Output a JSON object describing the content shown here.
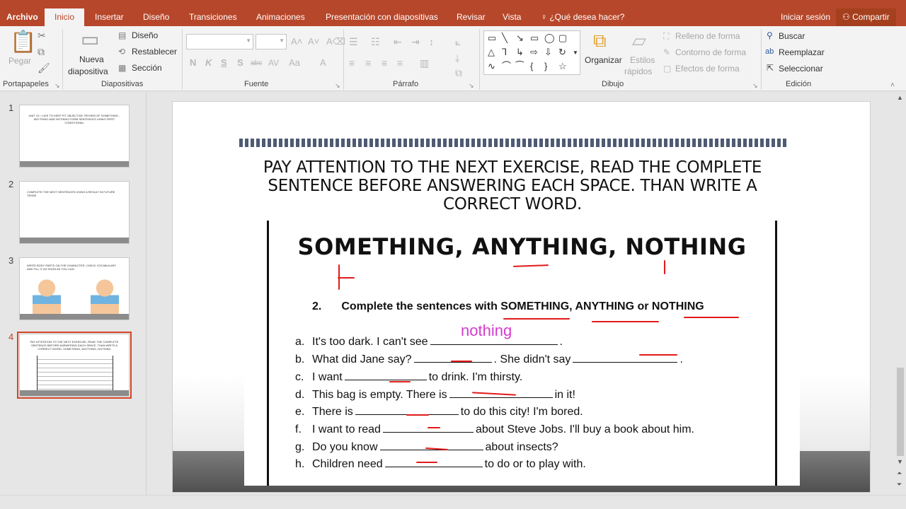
{
  "tabs": {
    "file": "Archivo",
    "home": "Inicio",
    "insert": "Insertar",
    "design": "Diseño",
    "transitions": "Transiciones",
    "animations": "Animaciones",
    "slideshow": "Presentación con diapositivas",
    "review": "Revisar",
    "view": "Vista",
    "tell_me": "¿Qué desea hacer?",
    "signin": "Iniciar sesión",
    "share": "Compartir"
  },
  "ribbon": {
    "clipboard": {
      "label": "Portapapeles",
      "paste": "Pegar"
    },
    "slides": {
      "label": "Diapositivas",
      "new_slide_1": "Nueva",
      "new_slide_2": "diapositiva",
      "layout": "Diseño",
      "reset": "Restablecer",
      "section": "Sección"
    },
    "font": {
      "label": "Fuente",
      "font_name": "",
      "font_size": ""
    },
    "paragraph": {
      "label": "Párrafo"
    },
    "drawing": {
      "label": "Dibujo",
      "arrange": "Organizar",
      "quick_styles_1": "Estilos",
      "quick_styles_2": "rápidos",
      "shape_fill": "Relleno de forma",
      "shape_outline": "Contorno de forma",
      "shape_effects": "Efectos de forma"
    },
    "editing": {
      "label": "Edición",
      "find": "Buscar",
      "replace": "Reemplazar",
      "select": "Seleccionar"
    }
  },
  "thumbnails": [
    {
      "number": "1",
      "text": "UNIT 10: I LIKE TO KEEP FIT OBJECTIVE: REVIEW OF SOMETHING - ANYTHING AND NOTHING FORM SENTENCES USING FIRST CONDITIONAL"
    },
    {
      "number": "2",
      "text": "COMPLETE THE NEXT SENTENCES USING A RESULT IN FUTURE TENSE"
    },
    {
      "number": "3",
      "text": "WRITE BODY PARTS ON THE CHARACTER, CHECK VOCABULARY AND FILL IT AS SOON AS YOU CAN"
    },
    {
      "number": "4",
      "text": "PAY ATTENTION TO THE NEXT EXERCISE, READ THE COMPLETE SENTENCE BEFORE ANSWERING EACH SPACE. THAN WRITE A CORRECT WORD. SOMETHING, ANYTHING, NOTHING"
    }
  ],
  "slide": {
    "heading": "PAY ATTENTION TO THE NEXT EXERCISE, READ THE COMPLETE SENTENCE BEFORE ANSWERING EACH SPACE. THAN WRITE A CORRECT WORD.",
    "worksheet": {
      "title": "SOMETHING, ANYTHING, NOTHING",
      "instr_num": "2.",
      "instr_text": "Complete the sentences with SOMETHING, ANYTHING or NOTHING",
      "handwritten": "nothing",
      "items": [
        {
          "letter": "a.",
          "pre": "It's too dark. I can't see",
          "post": "."
        },
        {
          "letter": "b.",
          "pre": "What did Jane say?",
          "mid": ". She didn't say",
          "post": "."
        },
        {
          "letter": "c.",
          "pre": "I want",
          "post": "to drink. I'm thirsty."
        },
        {
          "letter": "d.",
          "pre": "This bag is empty. There is",
          "post": "in it!"
        },
        {
          "letter": "e.",
          "pre": "There is",
          "post": "to do this city! I'm bored."
        },
        {
          "letter": "f.",
          "pre": "I want to read",
          "post": "about Steve Jobs. I'll buy a book about him."
        },
        {
          "letter": "g.",
          "pre": "Do you know",
          "post": "about insects?"
        },
        {
          "letter": "h.",
          "pre": "Children need",
          "post": "to do or to play with."
        }
      ]
    }
  }
}
